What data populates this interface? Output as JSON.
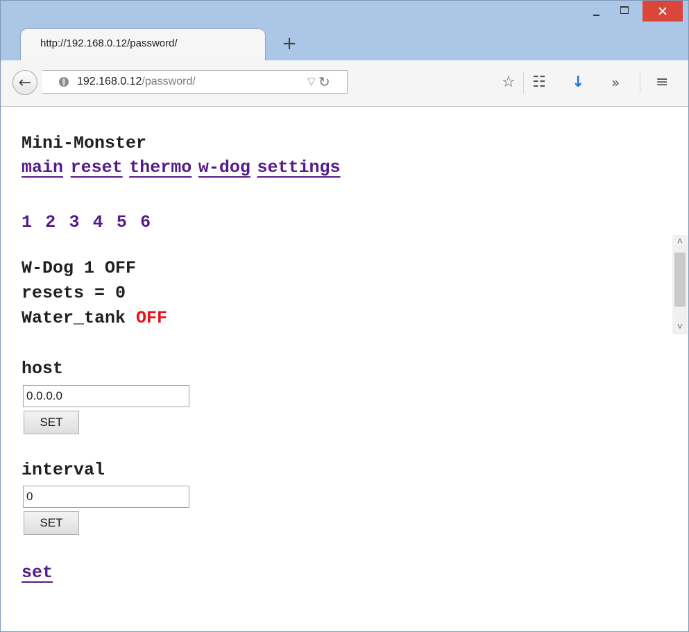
{
  "browser": {
    "tab_title": "http://192.168.0.12/password/",
    "new_tab_symbol": "+",
    "url_host": "192.168.0.12",
    "url_path": "/password/",
    "icons": [
      "back-arrow-icon",
      "globe-icon",
      "dropdown-history-icon",
      "reload-icon",
      "star-icon",
      "clipboard-icon",
      "download-icon",
      "overflow-icon",
      "hamburger-menu-icon",
      "minimize-icon",
      "maximize-icon",
      "close-icon"
    ],
    "close_button_color": "#d9473b"
  },
  "page": {
    "title": "Mini-Monster",
    "nav": [
      {
        "label": "main"
      },
      {
        "label": "reset"
      },
      {
        "label": "thermo"
      },
      {
        "label": "w-dog"
      },
      {
        "label": "settings"
      }
    ],
    "channels": [
      "1",
      "2",
      "3",
      "4",
      "5",
      "6"
    ],
    "status": {
      "wdog_line": "W-Dog 1 OFF",
      "resets_line": "resets = 0",
      "name": "Water_tank",
      "state": "OFF",
      "state_color": "#e4141b"
    },
    "host": {
      "label": "host",
      "value": "0.0.0.0",
      "button": "SET"
    },
    "interval": {
      "label": "interval",
      "value": "0",
      "button": "SET"
    },
    "set_link": "set",
    "link_color": "#551a8b"
  }
}
